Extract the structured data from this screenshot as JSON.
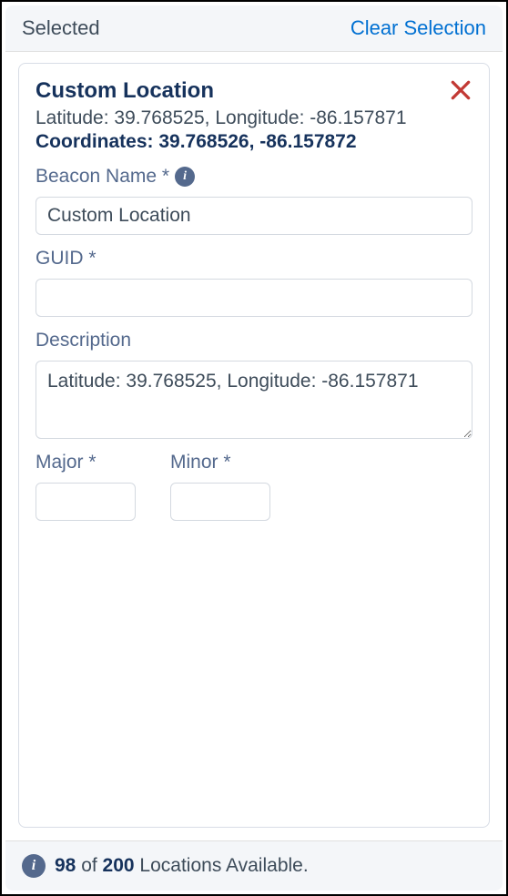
{
  "header": {
    "title": "Selected",
    "clear_label": "Clear Selection"
  },
  "card": {
    "title": "Custom Location",
    "latlong": "Latitude: 39.768525, Longitude: -86.157871",
    "coords": "Coordinates: 39.768526, -86.157872",
    "beacon_label": "Beacon Name *",
    "beacon_value": "Custom Location",
    "guid_label": "GUID *",
    "guid_value": "",
    "description_label": "Description",
    "description_value": "Latitude: 39.768525, Longitude: -86.157871",
    "major_label": "Major *",
    "major_value": "",
    "minor_label": "Minor *",
    "minor_value": ""
  },
  "footer": {
    "count_used": "98",
    "of_word": " of ",
    "count_total": "200",
    "suffix": " Locations Available."
  }
}
